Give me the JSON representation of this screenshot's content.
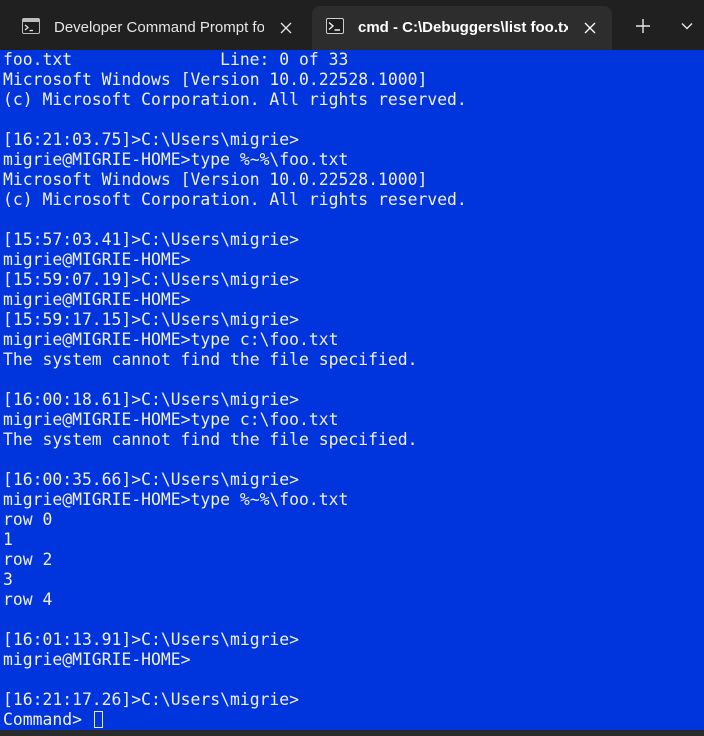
{
  "tabs": [
    {
      "title": "Developer Command Prompt for VS",
      "icon": "developer-prompt-icon",
      "active": false
    },
    {
      "title": "cmd - C:\\Debuggers\\list  foo.txt",
      "icon": "cmd-icon",
      "active": true
    }
  ],
  "tabbar": {
    "new_tab_glyph": "+",
    "dropdown_glyph": "⌄",
    "close_glyph": "✕"
  },
  "terminal": {
    "background": "#0034dd",
    "foreground": "#f0f0f0",
    "status_line": {
      "filename": "foo.txt",
      "position": "Line: 0 of 33"
    },
    "lines": [
      "Microsoft Windows [Version 10.0.22528.1000]",
      "(c) Microsoft Corporation. All rights reserved.",
      "",
      "[16:21:03.75]>C:\\Users\\migrie>",
      "migrie@MIGRIE-HOME>type %~%\\foo.txt",
      "Microsoft Windows [Version 10.0.22528.1000]",
      "(c) Microsoft Corporation. All rights reserved.",
      "",
      "[15:57:03.41]>C:\\Users\\migrie>",
      "migrie@MIGRIE-HOME>",
      "[15:59:07.19]>C:\\Users\\migrie>",
      "migrie@MIGRIE-HOME>",
      "[15:59:17.15]>C:\\Users\\migrie>",
      "migrie@MIGRIE-HOME>type c:\\foo.txt",
      "The system cannot find the file specified.",
      "",
      "[16:00:18.61]>C:\\Users\\migrie>",
      "migrie@MIGRIE-HOME>type c:\\foo.txt",
      "The system cannot find the file specified.",
      "",
      "[16:00:35.66]>C:\\Users\\migrie>",
      "migrie@MIGRIE-HOME>type %~%\\foo.txt",
      "row 0",
      "1",
      "row 2",
      "3",
      "row 4",
      "",
      "[16:01:13.91]>C:\\Users\\migrie>",
      "migrie@MIGRIE-HOME>",
      "",
      "[16:21:17.26]>C:\\Users\\migrie>"
    ],
    "command_prompt": "Command> "
  }
}
